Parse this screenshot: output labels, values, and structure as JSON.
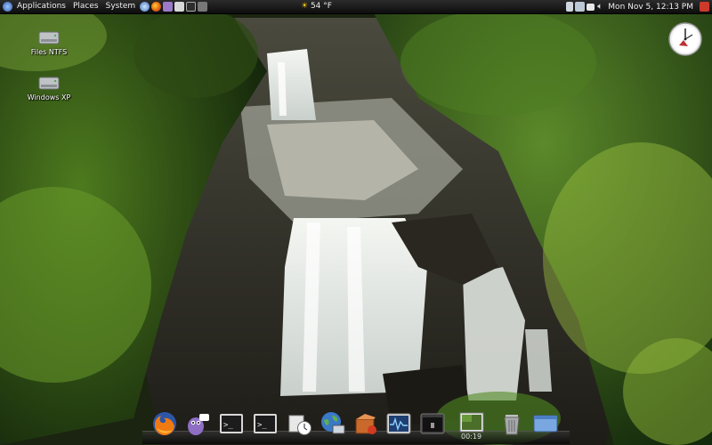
{
  "top_panel": {
    "menus": [
      "Applications",
      "Places",
      "System"
    ],
    "weather": "54 °F",
    "clock": "Mon Nov  5, 12:13 PM"
  },
  "desktop_icons": [
    {
      "label": "Files NTFS",
      "icon": "hard-drive-icon"
    },
    {
      "label": "Windows XP",
      "icon": "hard-drive-icon"
    }
  ],
  "dock": {
    "items": [
      "firefox-icon",
      "pidgin-icon",
      "terminal-icon",
      "terminal-icon",
      "clock-icon",
      "network-globe-icon",
      "package-manager-icon",
      "system-monitor-icon",
      "dark-window-icon",
      "workspace-switcher-icon",
      "trash-icon",
      "window-icon"
    ],
    "workspace_label": "00:19"
  },
  "colors": {
    "panel": "#1a1a1a",
    "accent_sun": "#f5c518"
  }
}
